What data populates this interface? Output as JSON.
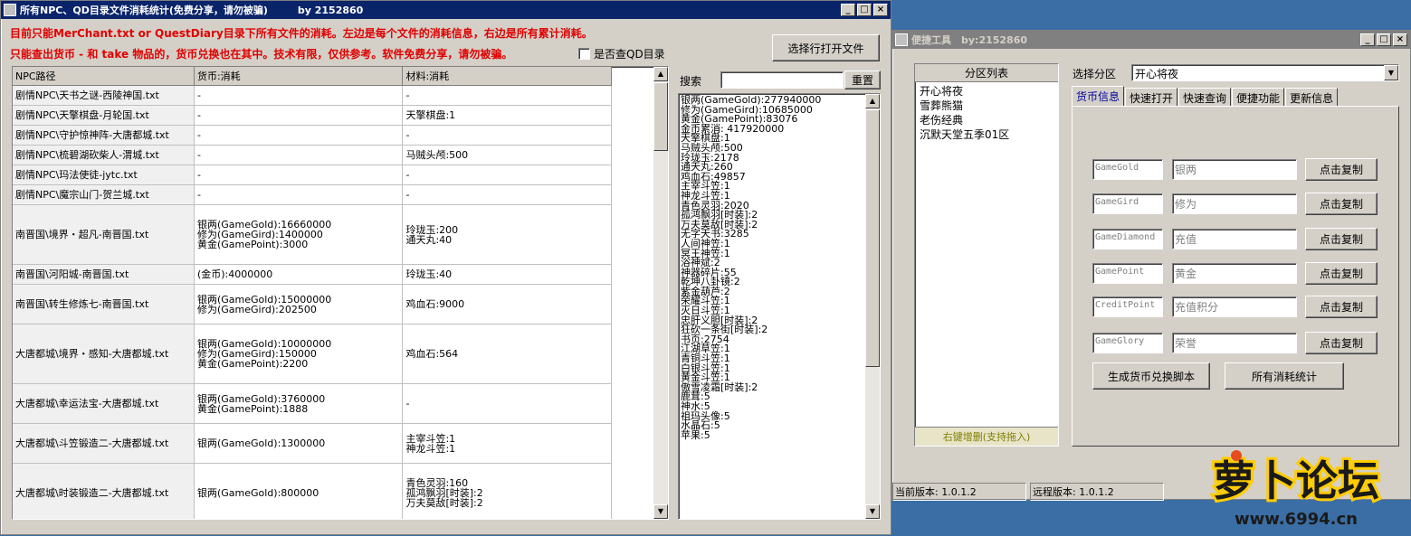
{
  "main_window": {
    "title": "所有NPC、QD目录文件消耗统计(免费分享，请勿被骗)　　　by 2152860",
    "info_line1": "目前只能MerChant.txt or QuestDiary目录下所有文件的消耗。左边是每个文件的消耗信息，右边是所有累计消耗。",
    "info_line2": "只能查出货币 - 和 take 物品的，货币兑换也在其中。技术有限，仅供参考。软件免费分享，请勿被骗。",
    "qd_checkbox_label": "是否查QD目录",
    "open_file_button": "选择行打开文件",
    "search_label": "搜索",
    "search_value": "",
    "reset_button": "重置",
    "columns": [
      "NPC路径",
      "货币:消耗",
      "材料:消耗"
    ],
    "rows": [
      {
        "path": "剧情NPC\\天书之谜-西陵神国.txt",
        "currency": "-",
        "material": "-"
      },
      {
        "path": "剧情NPC\\天擎棋盘-月轮国.txt",
        "currency": "-",
        "material": "天擎棋盘:1"
      },
      {
        "path": "剧情NPC\\守护惊神阵-大唐都城.txt",
        "currency": "-",
        "material": "-"
      },
      {
        "path": "剧情NPC\\梳碧湖砍柴人-渭城.txt",
        "currency": "-",
        "material": "马贼头颅:500"
      },
      {
        "path": "剧情NPC\\玛法使徒-jytc.txt",
        "currency": "-",
        "material": "-"
      },
      {
        "path": "剧情NPC\\魔宗山门-贺兰城.txt",
        "currency": "-",
        "material": "-"
      },
      {
        "path": "南晋国\\境界・超凡-南晋国.txt",
        "currency": "银两(GameGold):16660000\n修为(GameGird):1400000\n黄金(GamePoint):3000",
        "material": "玲珑玉:200\n通天丸:40"
      },
      {
        "path": "南晋国\\河阳城-南晋国.txt",
        "currency": "(金币):4000000",
        "material": "玲珑玉:40"
      },
      {
        "path": "南晋国\\转生修炼七-南晋国.txt",
        "currency": "银两(GameGold):15000000\n修为(GameGird):202500",
        "material": "鸡血石:9000"
      },
      {
        "path": "大唐都城\\境界・感知-大唐都城.txt",
        "currency": "银两(GameGold):10000000\n修为(GameGird):150000\n黄金(GamePoint):2200",
        "material": "鸡血石:564"
      },
      {
        "path": "大唐都城\\幸运法宝-大唐都城.txt",
        "currency": "银两(GameGold):3760000\n黄金(GamePoint):1888",
        "material": "-"
      },
      {
        "path": "大唐都城\\斗笠锻造二-大唐都城.txt",
        "currency": "银两(GameGold):1300000",
        "material": "主宰斗笠:1\n神龙斗笠:1"
      },
      {
        "path": "大唐都城\\时装锻造二-大唐都城.txt",
        "currency": "银两(GameGold):800000",
        "material": "青色灵羽:160\n孤鸿飘羽[时装]:2\n万夫莫敌[时装]:2"
      }
    ],
    "totals": [
      "银两(GameGold):277940000",
      "修为(GameGird):10685000",
      "黄金(GamePoint):83076",
      "金币累消: 417920000",
      "天擎棋盘:1",
      "马贼头颅:500",
      "玲珑玉:2178",
      "通天丸:260",
      "鸡血石:49857",
      "主宰斗笠:1",
      "神龙斗笠:1",
      "青色灵羽:2020",
      "孤鸿飘羽[时装]:2",
      "万夫莫敌[时装]:2",
      "无字天书:3285",
      "人间神笠:1",
      "冥王神笠:1",
      "浴神斌:2",
      "神器碎片:55",
      "乾坤八卦镜:2",
      "紫金葫芦:2",
      "荣耀斗笠:1",
      "灭日斗笠:1",
      "忠肝义胆[时装]:2",
      "狂砍一条街[时装]:2",
      "书页:2754",
      "江湖草笠:1",
      "青铜斗笠:1",
      "白银斗笠:1",
      "黄金斗笠:1",
      "傲雪凌霜[时装]:2",
      "鹿茸:5",
      "神水:5",
      "祖玛头像:5",
      "水晶石:5",
      "苹果:5"
    ]
  },
  "tool_window": {
    "title": "便捷工具　by:2152860",
    "zone_list_header": "分区列表",
    "zones": [
      "开心将夜",
      "雪葬熊猫",
      "老伤经典",
      "沉默天堂五季01区"
    ],
    "zone_list_footer": "右键增删(支持拖入)",
    "select_zone_label": "选择分区",
    "selected_zone": "开心将夜",
    "tabs": [
      "货币信息",
      "快速打开",
      "快速查询",
      "便捷功能",
      "更新信息"
    ],
    "currencies": [
      {
        "code": "GameGold",
        "name": "银两",
        "button": "点击复制"
      },
      {
        "code": "GameGird",
        "name": "修为",
        "button": "点击复制"
      },
      {
        "code": "GameDiamond",
        "name": "充值",
        "button": "点击复制"
      },
      {
        "code": "GamePoint",
        "name": "黄金",
        "button": "点击复制"
      },
      {
        "code": "CreditPoint",
        "name": "充值积分",
        "button": "点击复制"
      },
      {
        "code": "GameGlory",
        "name": "荣誉",
        "button": "点击复制"
      }
    ],
    "gen_script_button": "生成货币兑换脚本",
    "all_stats_button": "所有消耗统计",
    "current_version": "当前版本: 1.0.1.2",
    "remote_version": "远程版本: 1.0.1.2"
  },
  "watermark": {
    "text": "萝卜论坛",
    "url": "www.6994.cn"
  }
}
